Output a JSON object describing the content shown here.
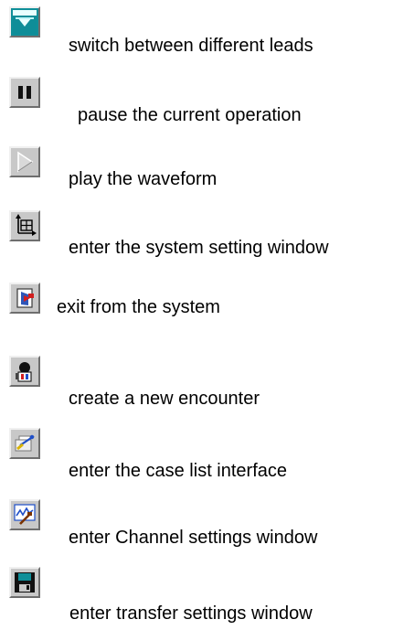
{
  "items": [
    {
      "icon": "switch-leads-icon",
      "label": "switch between different leads"
    },
    {
      "icon": "pause-icon",
      "label": "pause the current operation"
    },
    {
      "icon": "play-icon",
      "label": "play the waveform"
    },
    {
      "icon": "system-setting-icon",
      "label": "enter the system setting window"
    },
    {
      "icon": "exit-icon",
      "label": "exit from the system"
    },
    {
      "icon": "new-encounter-icon",
      "label": "create a new encounter"
    },
    {
      "icon": "case-list-icon",
      "label": "enter the case list interface"
    },
    {
      "icon": "channel-settings-icon",
      "label": "enter Channel settings window"
    },
    {
      "icon": "floppy-disk-icon",
      "label": "enter transfer settings window"
    }
  ],
  "colors": {
    "icon_face": "#c8c8c8",
    "accent_teal": "#178f9f",
    "accent_red": "#d21e1e",
    "accent_blue": "#1f4fc8"
  }
}
